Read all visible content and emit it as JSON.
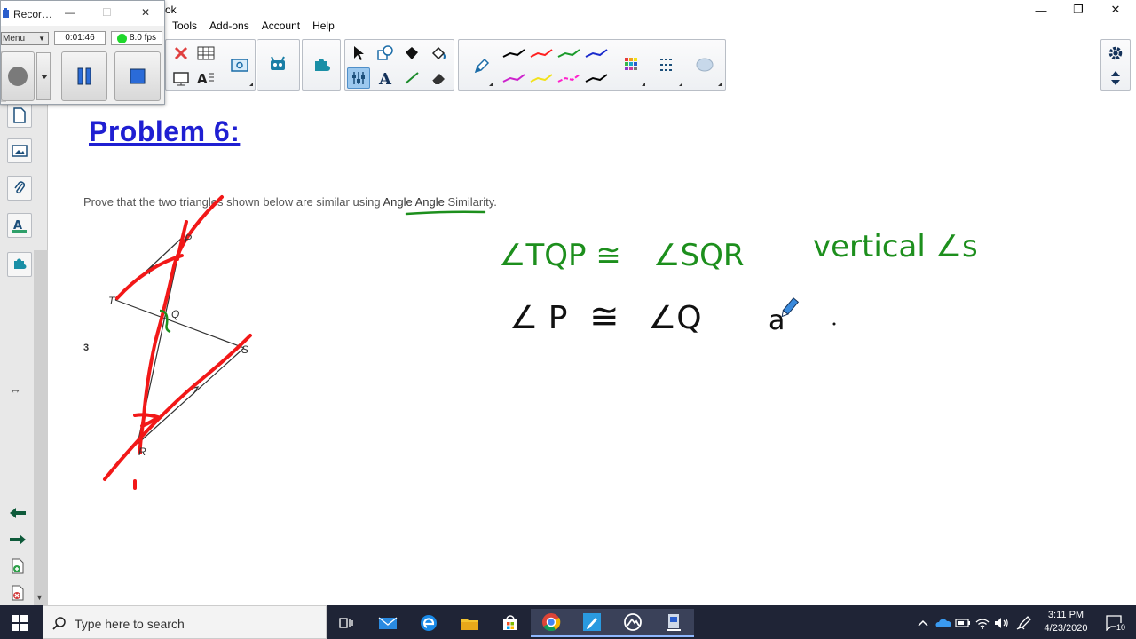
{
  "window": {
    "title_fragment": "ok",
    "minimize_glyph": "—",
    "restore_glyph": "❐",
    "close_glyph": "✕"
  },
  "menu": {
    "items": [
      "Tools",
      "Add-ons",
      "Account",
      "Help"
    ]
  },
  "recorder": {
    "title": "Recor…",
    "menu_label": "Menu",
    "elapsed": "0:01:46",
    "fps": "8.0 fps",
    "fps_indicator_color": "#1fd82c",
    "min_glyph": "—",
    "max_glyph": "☐",
    "close_glyph": "✕"
  },
  "toolbar": {
    "tools": [
      "select-arrow",
      "shapes",
      "fill",
      "paint-bucket",
      "pen",
      "text",
      "line",
      "eraser",
      "table",
      "delete",
      "screen-shade",
      "text-style",
      "capture",
      "widgets",
      "addon-puzzle",
      "settings",
      "expand-toolbar"
    ],
    "pen_colors": [
      "#000000",
      "#ff2020",
      "#1a9a2a",
      "#1a2acc",
      "#cc22cc",
      "#f2e21a",
      "#ff22cc",
      "#000000"
    ],
    "active_tool": "properties"
  },
  "canvas": {
    "heading": "Problem 6:",
    "prompt_before": "Prove that the two triangles shown below are similar using ",
    "prompt_emphasis": "Angle Angle",
    "prompt_after": " Similarity.",
    "diagram_labels": {
      "P": "P",
      "T": "T",
      "Q": "Q",
      "S": "S",
      "R": "R"
    },
    "margin_mark": "3",
    "handwriting": {
      "line1_left": "∠TQP ≅",
      "line1_right": "∠SQR",
      "line1_reason": "vertical ∠s",
      "line2_left": "∠ P",
      "line2_eq": "≅",
      "line2_right": "∠Q",
      "line2_reason": "a",
      "green": "#1d8f1d",
      "black": "#111111",
      "red": "#f21818"
    },
    "pen_cursor": "pen-cursor-icon"
  },
  "sidebar": {
    "nav_colors": {
      "back_arrow": "#0e5a3a",
      "forward_arrow": "#0e5a3a"
    },
    "resize_glyph": "↔"
  },
  "taskbar": {
    "search_placeholder": "Type here to search",
    "time": "3:11 PM",
    "date": "4/23/2020",
    "notification_count": "10"
  }
}
